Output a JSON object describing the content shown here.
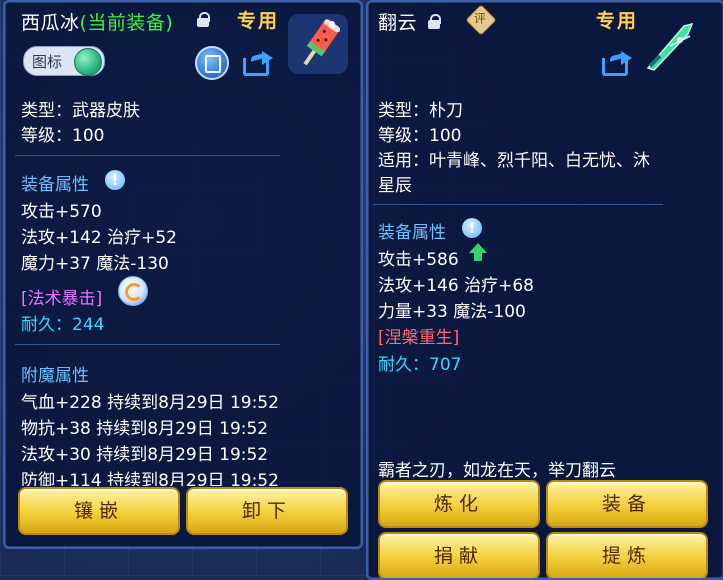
{
  "left": {
    "title_name": "西瓜冰",
    "title_qualifier": "(当前装备)",
    "zhuanyong": "专用",
    "icon_toggle_label": "图标",
    "lines": {
      "type": "类型：武器皮肤",
      "level": "等级：100"
    },
    "section_equip": "装备属性",
    "attrs": [
      "攻击+570",
      "法攻+142 治疗+52",
      "魔力+37 魔法-130"
    ],
    "special": "[法术暴击]",
    "durability": "耐久：244",
    "section_enchant": "附魔属性",
    "enchants": [
      "气血+228 持续到8月29日 19:52",
      "物抗+38 持续到8月29日 19:52",
      "法攻+30 持续到8月29日 19:52",
      "防御+114 持续到8月29日 19:52"
    ],
    "buttons": {
      "inlay": "镶嵌",
      "unequip": "卸下"
    }
  },
  "right": {
    "title_name": "翻云",
    "ping_badge": "评",
    "zhuanyong": "专用",
    "lines": {
      "type": "类型：朴刀",
      "level": "等级：100",
      "applicable_1": "适用：叶青峰、烈千阳、白无忧、沐",
      "applicable_2": "星辰"
    },
    "section_equip": "装备属性",
    "attrs": [
      "攻击+586",
      "法攻+146 治疗+68",
      "力量+33 魔法-100"
    ],
    "special": "[涅槃重生]",
    "durability": "耐久：707",
    "flavor": "霸者之刃，如龙在天，举刀翻云",
    "buttons": {
      "refine": "炼化",
      "equip": "装备",
      "donate": "捐献",
      "extract": "提炼"
    }
  },
  "colors": {
    "title_white": "#ffffff",
    "qualifier_green": "#3df23d",
    "zhuanyong_gold": "#ffd24a",
    "section_blue": "#6cc0ff",
    "special_magenta": "#e874ff",
    "special_red": "#ff6a6a",
    "durability_cyan": "#3ad8ff",
    "button_gold": "#f4cf3a"
  },
  "icons": [
    "lock-icon",
    "watermelon-weapon-icon",
    "record-icon",
    "share-icon",
    "info-icon",
    "refresh-icon",
    "up-arrow-icon",
    "blade-weapon-icon",
    "rating-badge-icon"
  ]
}
